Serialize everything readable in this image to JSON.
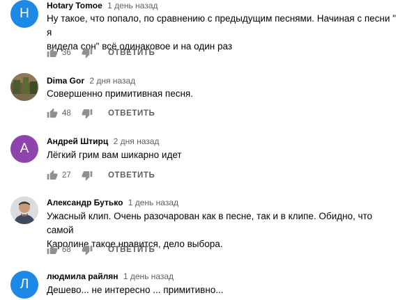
{
  "comments": [
    {
      "author": "Hotary Tomoe",
      "time": "1 день назад",
      "avatar_letter": "H",
      "avatar_color": "#1e88e5",
      "text_lines": [
        "Ну такое, что попало, по сравнению с предыдущим песнями. Начиная с песни \" я",
        "видела сон\" всё одинаковое и на один раз"
      ],
      "likes": "36",
      "reply_label": "ОТВЕТИТЬ"
    },
    {
      "author": "Dima Gor",
      "time": "2 дня назад",
      "avatar_letter": "",
      "avatar_color": "#6b5a3c",
      "text_lines": [
        "Совершенно примитивная песня."
      ],
      "likes": "48",
      "reply_label": "ОТВЕТИТЬ"
    },
    {
      "author": "Андрей Штирц",
      "time": "2 дня назад",
      "avatar_letter": "А",
      "avatar_color": "#8e44ad",
      "text_lines": [
        "Лёгкий грим вам шикарно идет"
      ],
      "likes": "27",
      "reply_label": "ОТВЕТИТЬ"
    },
    {
      "author": "Александр Бутько",
      "time": "1 день назад",
      "avatar_letter": "",
      "avatar_color": "#d9dde2",
      "text_lines": [
        "Ужасный клип. Очень разочарован как в песне, так и в клипе. Обидно, что самой",
        "Каролине такое нравится, дело выбора."
      ],
      "likes": "68",
      "reply_label": "ОТВЕТИТЬ"
    },
    {
      "author": "людмила райлян",
      "time": "1 день назад",
      "avatar_letter": "Л",
      "avatar_color": "#1e88e5",
      "text_lines": [
        "Дешево... не интересно ... примитивно..."
      ],
      "likes": "",
      "reply_label": ""
    }
  ],
  "icons": {
    "like": "thumbs-up-icon",
    "dislike": "thumbs-down-icon"
  },
  "colors": {
    "secondary_text": "#606060",
    "icon": "#909090"
  }
}
